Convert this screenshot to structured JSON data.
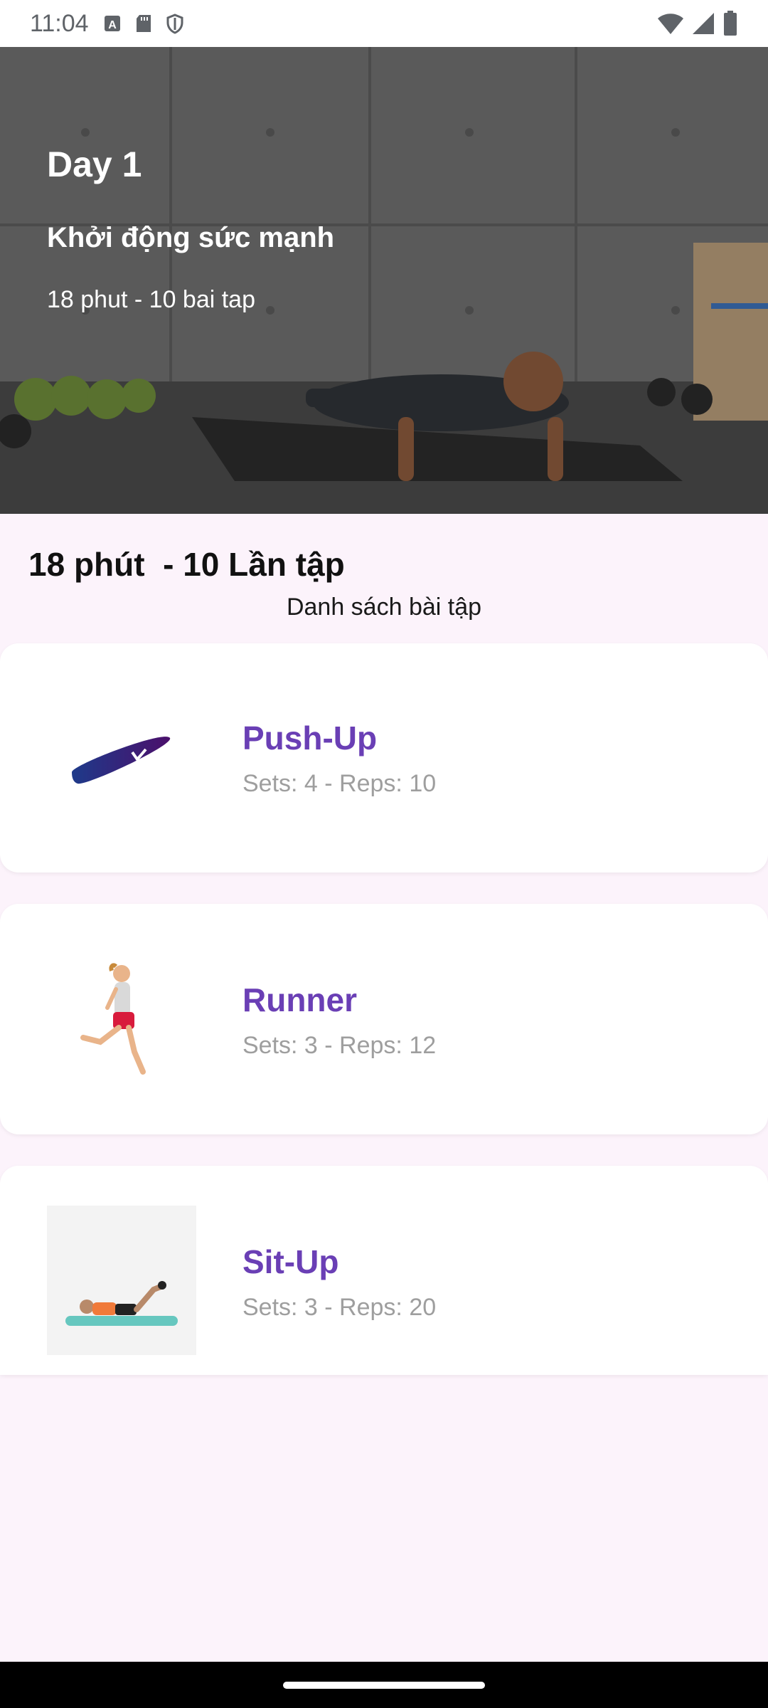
{
  "status_bar": {
    "time": "11:04",
    "left_icons": [
      "text-a-icon",
      "sd-card-icon",
      "shield-icon"
    ],
    "right_icons": [
      "wifi-icon",
      "signal-icon",
      "battery-icon"
    ]
  },
  "hero": {
    "day": "Day 1",
    "title": "Khởi động sức mạnh",
    "subtitle": "18 phut - 10 bai tap",
    "image": "pushup-photo"
  },
  "summary": "18 phút  - 10 Lần tập",
  "list_title": "Danh sách bài tập",
  "exercises": [
    {
      "name": "Push-Up",
      "meta": "Sets: 4 - Reps: 10",
      "icon": "pushup-icon"
    },
    {
      "name": "Runner",
      "meta": "Sets: 3 - Reps: 12",
      "icon": "runner-icon"
    },
    {
      "name": "Sit-Up",
      "meta": "Sets: 3 - Reps: 20",
      "icon": "situp-icon"
    }
  ],
  "colors": {
    "accent": "#6a3fb5",
    "background": "#fcf3fb",
    "meta_text": "#9e9e9e"
  }
}
